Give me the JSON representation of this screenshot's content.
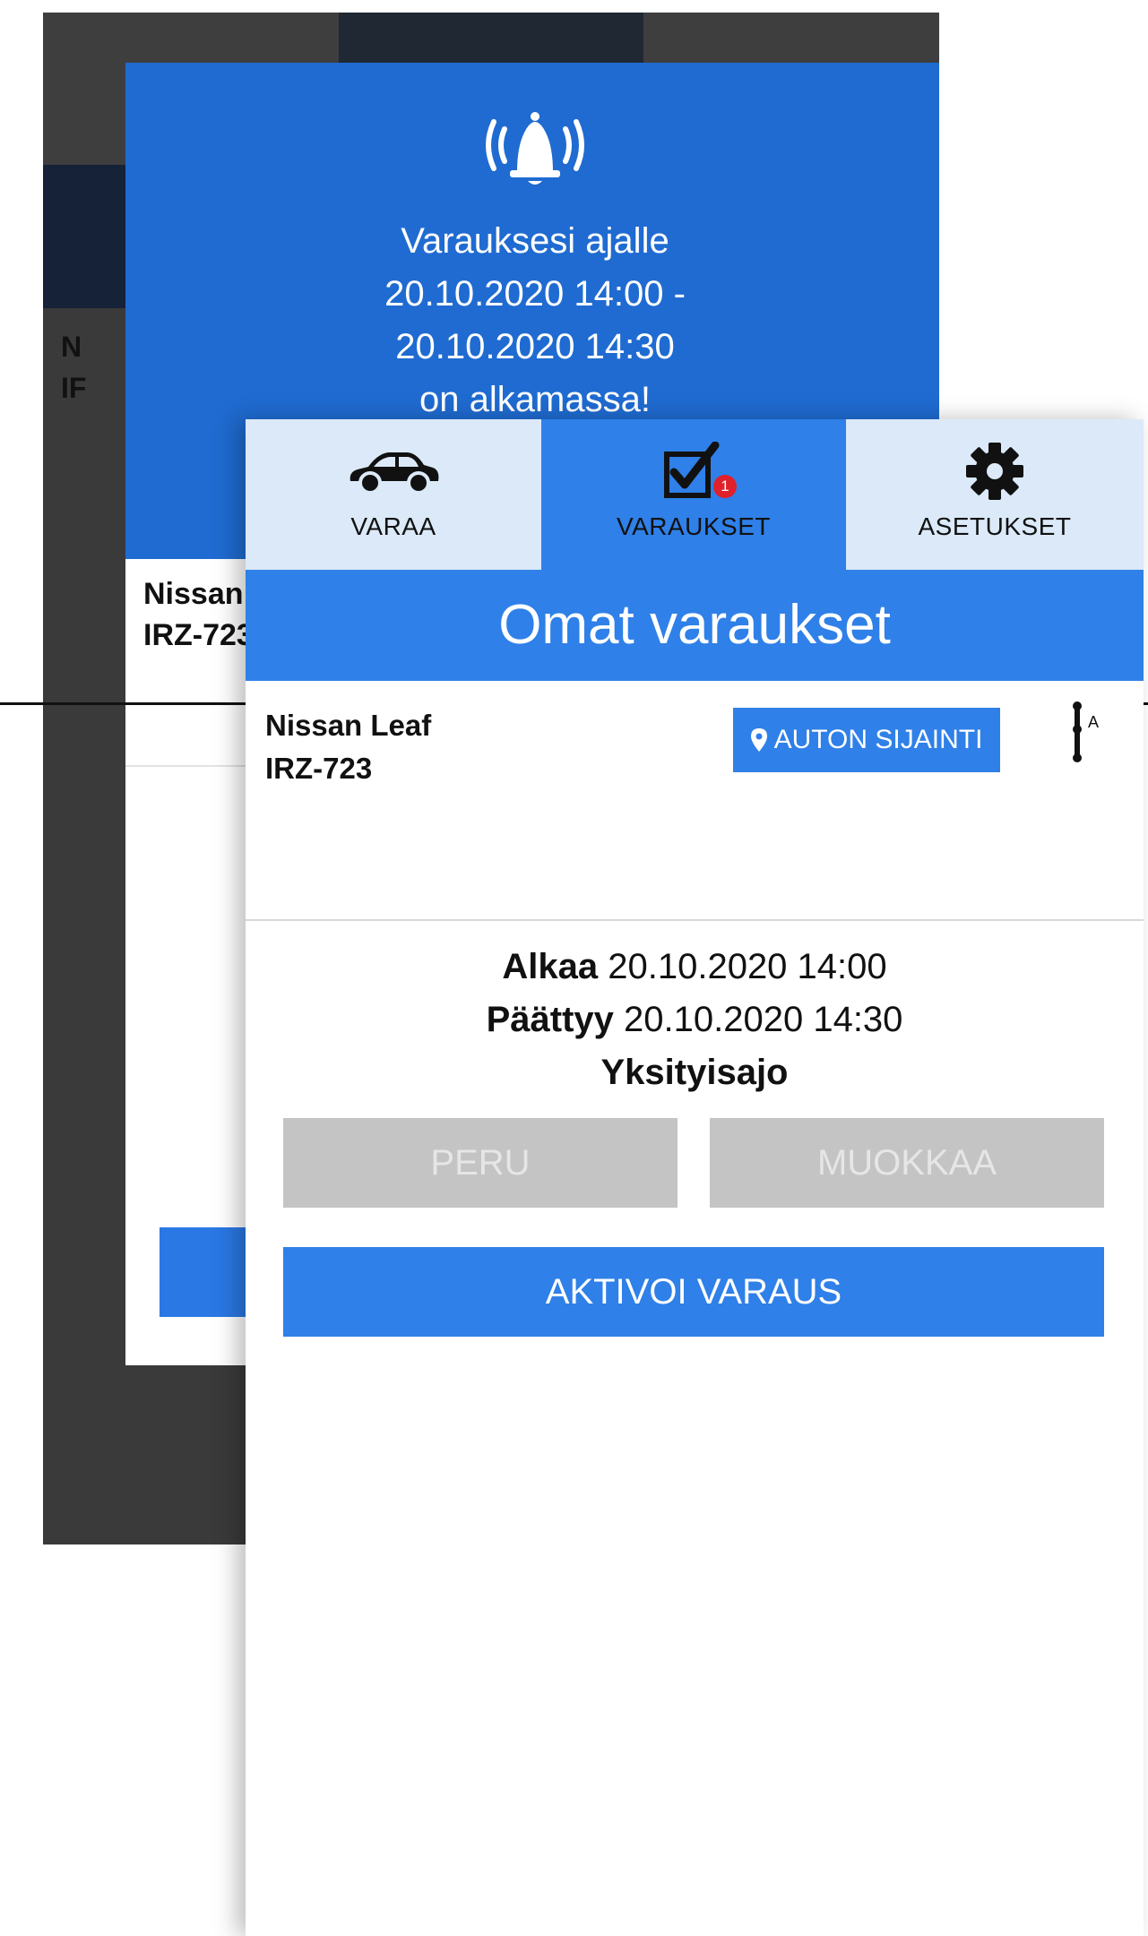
{
  "alert": {
    "message_lines": [
      "Varauksesi ajalle",
      "20.10.2020 14:00 -",
      "20.10.2020 14:30",
      "on alkamassa!"
    ],
    "car_model": "Nissan",
    "car_plate": "IRZ-723",
    "back_partial_lines": [
      "N",
      "IF"
    ]
  },
  "tabs": [
    {
      "label": "VARAA",
      "icon": "car-icon",
      "active": false
    },
    {
      "label": "VARAUKSET",
      "icon": "checkbox-icon",
      "active": true,
      "badge": "1"
    },
    {
      "label": "ASETUKSET",
      "icon": "gear-icon",
      "active": false
    }
  ],
  "header": {
    "title": "Omat varaukset"
  },
  "booking": {
    "car_model": "Nissan Leaf",
    "car_plate": "IRZ-723",
    "location_button": "AUTON SIJAINTI",
    "sort_letter": "A",
    "start_label": "Alkaa",
    "start_value": "20.10.2020 14:00",
    "end_label": "Päättyy",
    "end_value": "20.10.2020 14:30",
    "trip_type": "Yksityisajo",
    "cancel_label": "PERU",
    "edit_label": "MUOKKAA",
    "activate_label": "AKTIVOI VARAUS"
  },
  "colors": {
    "primary": "#2f80e8",
    "alert_blue": "#1f6bd1",
    "tab_inactive": "#dbe9f8",
    "badge": "#e0202b",
    "disabled": "#c4c4c4"
  }
}
